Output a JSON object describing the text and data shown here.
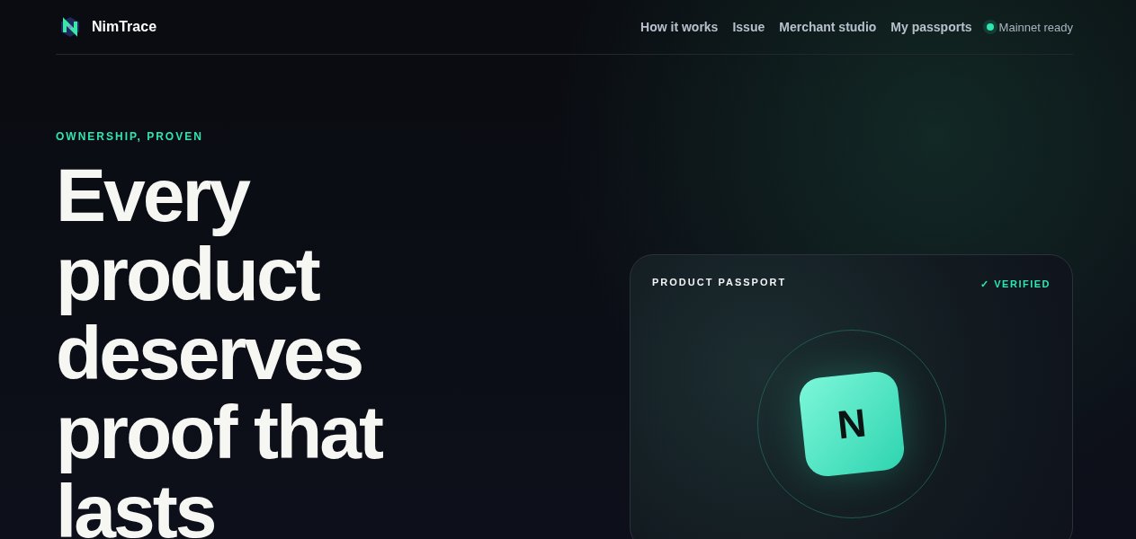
{
  "brand": {
    "name": "NimTrace"
  },
  "nav": {
    "links": [
      "How it works",
      "Issue",
      "Merchant studio",
      "My passports"
    ],
    "status": {
      "label": "Mainnet ready",
      "online": true
    }
  },
  "hero": {
    "eyebrow": "OWNERSHIP, PROVEN",
    "headline": "Every product deserves proof that lasts"
  },
  "passport_card": {
    "title": "PRODUCT PASSPORT",
    "badge": "✓ VERIFIED",
    "verified": true,
    "emblem_letter": "N"
  }
}
